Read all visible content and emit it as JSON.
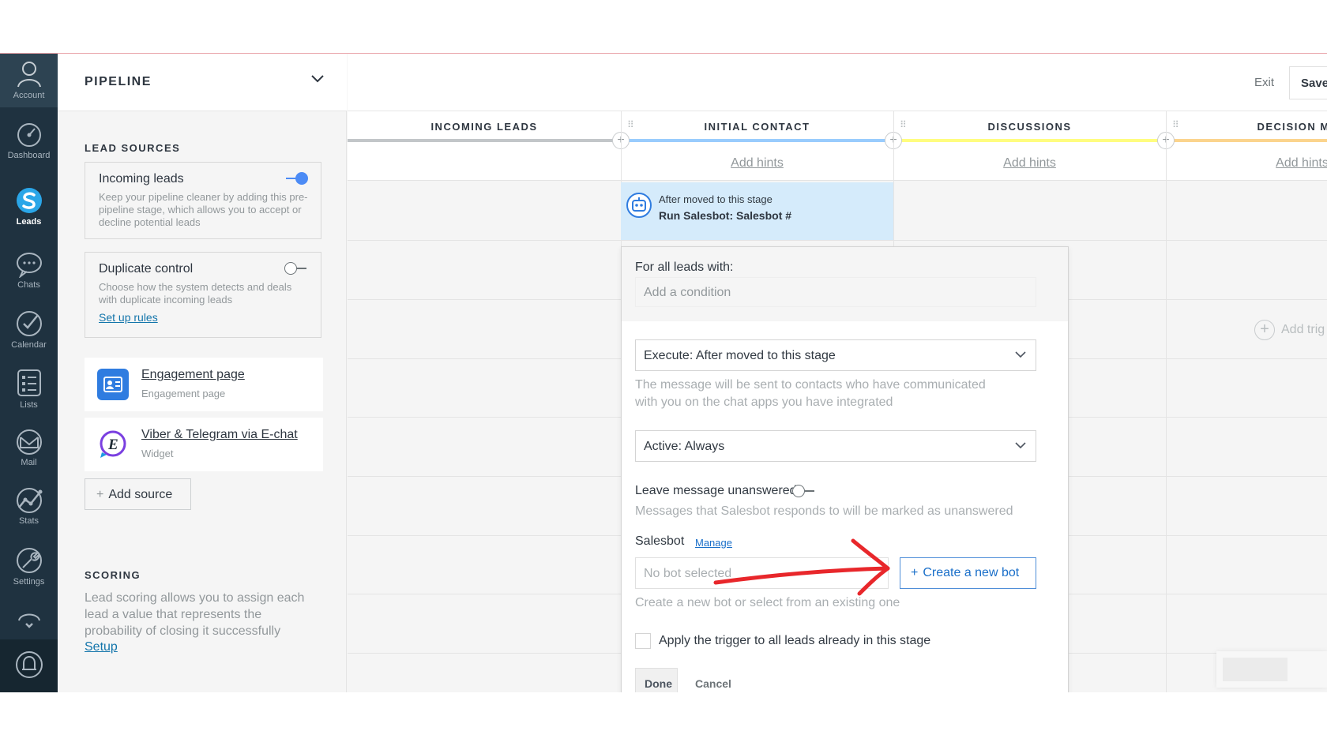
{
  "nav": {
    "items": [
      {
        "label": "Account",
        "icon": "user-icon"
      },
      {
        "label": "Dashboard",
        "icon": "gauge-icon"
      },
      {
        "label": "Leads",
        "icon": "leads-icon",
        "active": true
      },
      {
        "label": "Chats",
        "icon": "chat-icon"
      },
      {
        "label": "Calendar",
        "icon": "check-circle-icon"
      },
      {
        "label": "Lists",
        "icon": "list-icon"
      },
      {
        "label": "Mail",
        "icon": "mail-icon"
      },
      {
        "label": "Stats",
        "icon": "stats-icon"
      },
      {
        "label": "Settings",
        "icon": "wrench-icon"
      }
    ]
  },
  "sidebar": {
    "title": "PIPELINE",
    "lead_sources_title": "LEAD SOURCES",
    "incoming": {
      "title": "Incoming leads",
      "desc": "Keep your pipeline cleaner by adding this pre-pipeline stage, which allows you to accept or decline potential leads",
      "enabled": true
    },
    "duplicate": {
      "title": "Duplicate control",
      "desc": "Choose how the system detects and deals with duplicate incoming leads",
      "link": "Set up rules",
      "enabled": false
    },
    "sources": [
      {
        "title": "Engagement page",
        "sub": "Engagement page"
      },
      {
        "title": "Viber & Telegram via E-chat",
        "sub": "Widget"
      }
    ],
    "add_source": "Add source",
    "scoring_title": "SCORING",
    "scoring_desc": "Lead scoring allows you to assign each lead a value that represents the probability of closing it successfully",
    "scoring_link": "Setup"
  },
  "topbar": {
    "exit": "Exit",
    "save": "Save"
  },
  "columns": [
    {
      "title": "INCOMING LEADS",
      "color": "#c2c6c9",
      "hint": ""
    },
    {
      "title": "INITIAL CONTACT",
      "color": "#99ccfd",
      "hint": "Add hints"
    },
    {
      "title": "DISCUSSIONS",
      "color": "#fffd7f",
      "hint": "Add hints"
    },
    {
      "title": "DECISION MAK",
      "color": "#fbd48d",
      "hint": "Add hints"
    }
  ],
  "bot_block": {
    "pre": "After moved to this stage",
    "name": "Run Salesbot: Salesbot #"
  },
  "add_trigger": "Add trig",
  "popup": {
    "for_all": "For all leads with:",
    "condition_placeholder": "Add a condition",
    "execute": "Execute: After moved to this stage",
    "execute_note_1": "The message will be sent to contacts who have communicated",
    "execute_note_2": "with you on the chat apps you have integrated",
    "active": "Active: Always",
    "leave_unanswered": "Leave message unanswered",
    "unanswered_note": "Messages that Salesbot responds to will be marked as unanswered",
    "salesbot_label": "Salesbot",
    "manage": "Manage",
    "no_bot": "No bot selected",
    "create_bot": "Create a new bot",
    "create_note": "Create a new bot or select from an existing one",
    "apply_all": "Apply the trigger to all leads already in this stage",
    "done": "Done",
    "cancel": "Cancel"
  },
  "colors": {
    "nav_bg": "#1f3240",
    "accent": "#4c8bf5",
    "annotation_arrow": "#e8272b"
  }
}
